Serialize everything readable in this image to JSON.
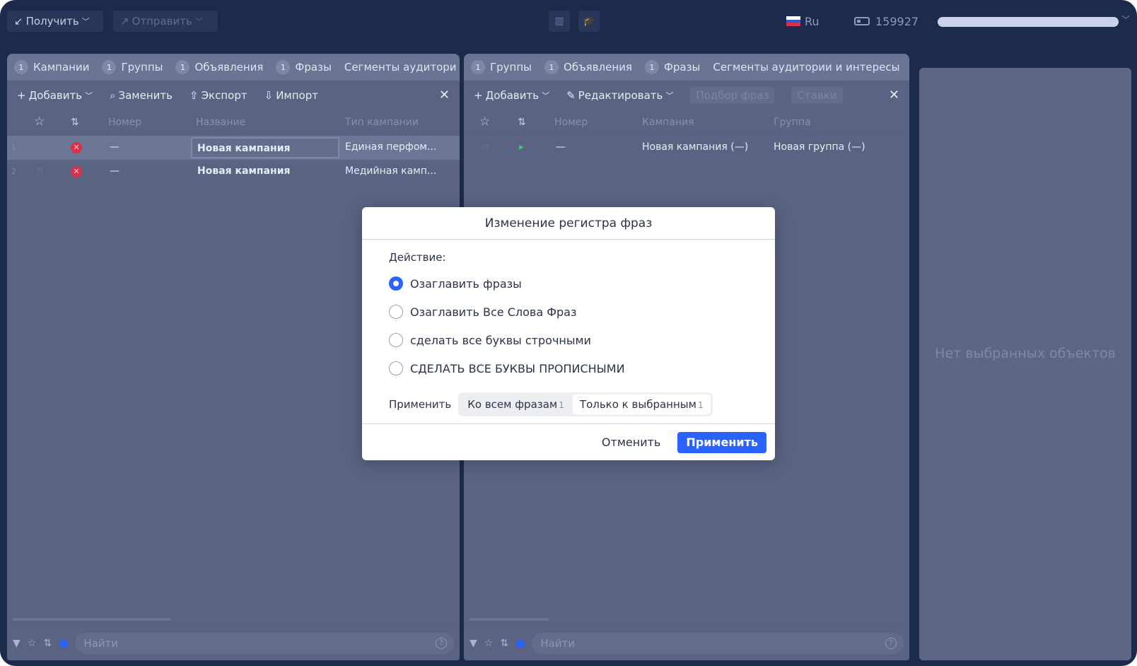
{
  "topbar": {
    "get_label": "Получить",
    "send_label": "Отправить",
    "lang": "Ru",
    "credits": "159927"
  },
  "left_panel": {
    "tabs": [
      {
        "count": "1",
        "label": "Кампании"
      },
      {
        "count": "1",
        "label": "Группы"
      },
      {
        "count": "1",
        "label": "Объявления"
      },
      {
        "count": "1",
        "label": "Фразы"
      },
      {
        "count": "",
        "label": "Сегменты аудитори"
      }
    ],
    "toolbar": {
      "add": "Добавить",
      "replace": "Заменить",
      "export": "Экспорт",
      "import": "Импорт"
    },
    "columns": [
      "Номер",
      "Название",
      "Тип кампании"
    ],
    "rows": [
      {
        "n": "1",
        "number": "—",
        "name": "Новая кампания",
        "type": "Единая перфом..."
      },
      {
        "n": "2",
        "number": "—",
        "name": "Новая кампания",
        "type": "Медийная камп..."
      }
    ],
    "search_placeholder": "Найти"
  },
  "mid_panel": {
    "tabs": [
      {
        "count": "1",
        "label": "Группы"
      },
      {
        "count": "1",
        "label": "Объявления"
      },
      {
        "count": "1",
        "label": "Фразы"
      },
      {
        "count": "",
        "label": "Сегменты аудитории и интересы"
      }
    ],
    "toolbar": {
      "add": "Добавить",
      "edit": "Редактировать",
      "phrase_pick": "Подбор фраз",
      "bids": "Ставки"
    },
    "columns": [
      "Номер",
      "Кампания",
      "Группа"
    ],
    "rows": [
      {
        "n": "1",
        "number": "—",
        "campaign": "Новая кампания (—)",
        "group": "Новая группа (—)"
      }
    ],
    "search_placeholder": "Найти"
  },
  "right_panel": {
    "empty_text": "Нет выбранных объектов"
  },
  "modal": {
    "title": "Изменение регистра фраз",
    "action_label": "Действие:",
    "options": [
      {
        "label": "Озаглавить фразы",
        "selected": true
      },
      {
        "label": "Озаглавить Все Слова Фраз",
        "selected": false
      },
      {
        "label": "сделать все буквы строчными",
        "selected": false
      },
      {
        "label": "СДЕЛАТЬ ВСЕ БУКВЫ ПРОПИСНЫМИ",
        "selected": false
      }
    ],
    "apply_label": "Применить",
    "scope": [
      {
        "label": "Ко всем фразам",
        "count": "1",
        "selected": false
      },
      {
        "label": "Только к выбранным",
        "count": "1",
        "selected": true
      }
    ],
    "cancel": "Отменить",
    "submit": "Применить"
  },
  "colors": {
    "frame": "#1c2a4b",
    "panel": "#5a6482",
    "accent": "#2962ff",
    "error": "#d8324a"
  }
}
